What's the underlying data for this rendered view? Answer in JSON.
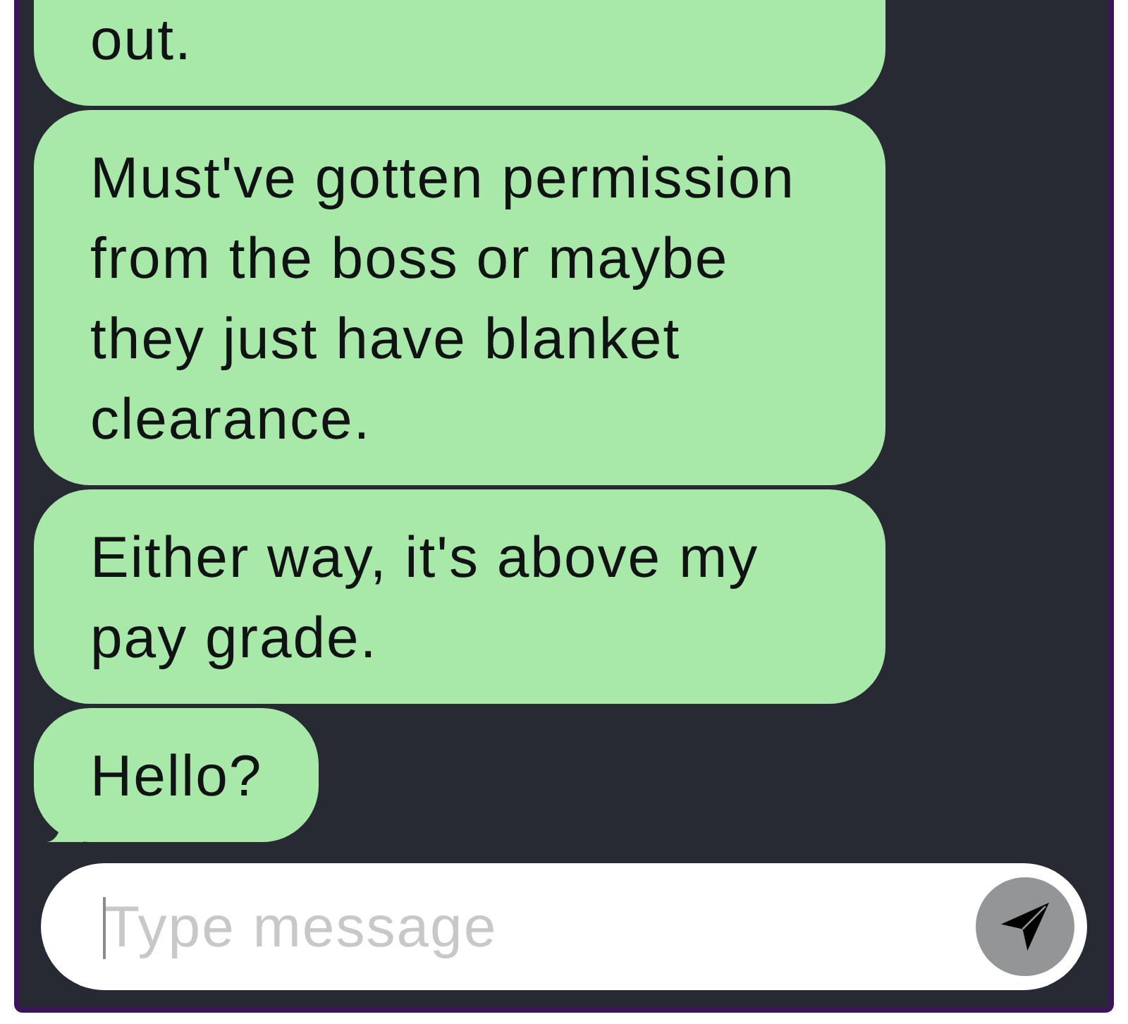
{
  "conversation": {
    "messages": [
      {
        "text": "out.",
        "cut_off": true,
        "tail": false
      },
      {
        "text": "Must've gotten permission from the boss or maybe they just have blanket clearance.",
        "cut_off": false,
        "tail": false
      },
      {
        "text": "Either way, it's above my pay grade.",
        "cut_off": false,
        "tail": false
      },
      {
        "text": "Hello?",
        "cut_off": false,
        "tail": true
      }
    ]
  },
  "composer": {
    "placeholder": "Type message"
  }
}
